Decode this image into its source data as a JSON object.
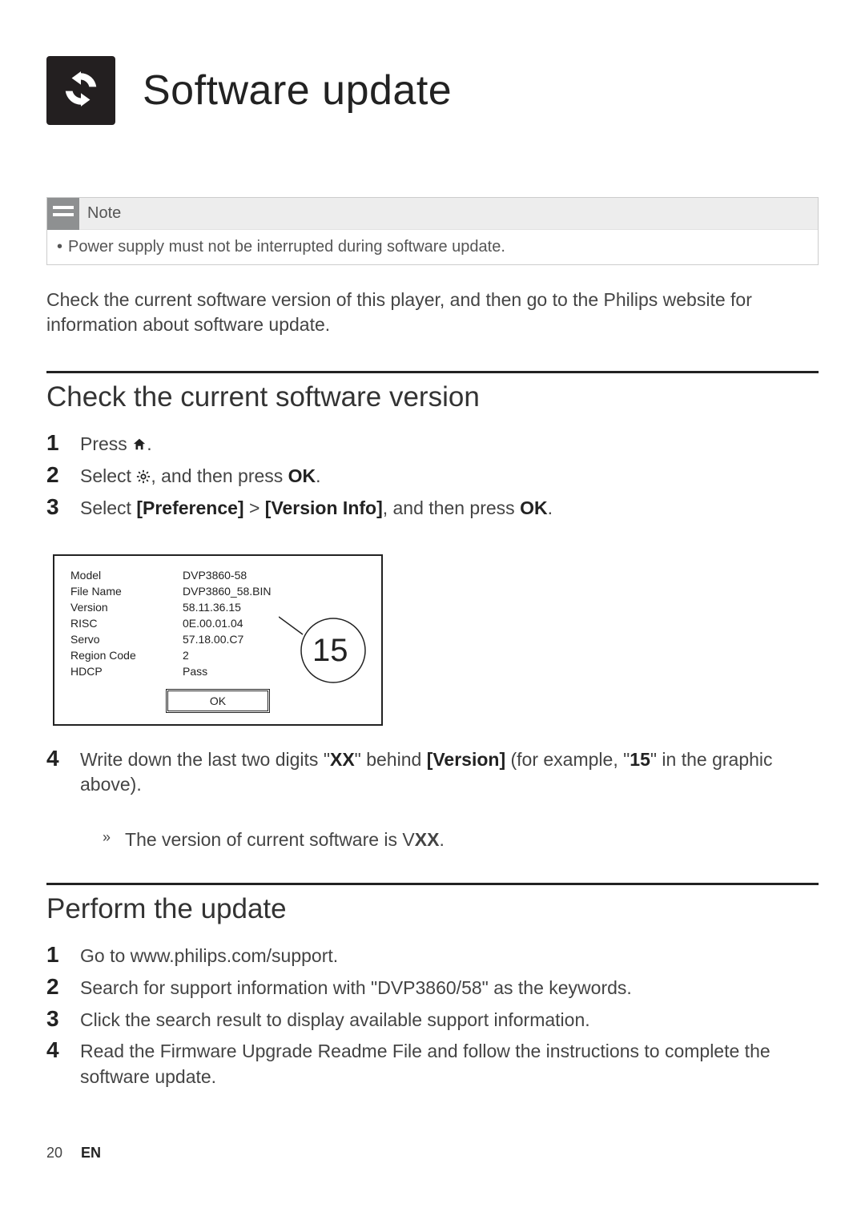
{
  "title": "Software update",
  "note_label": "Note",
  "note_text": "Power supply must not be interrupted during software update.",
  "intro": "Check the current software version of this player, and then go to the Philips website for information about software update.",
  "section1_title": "Check the current software version",
  "steps1": {
    "s1_pre": "Press ",
    "s1_post": ".",
    "s2_pre": "Select ",
    "s2_mid": ", and then press ",
    "s2_ok": "OK",
    "s2_post": ".",
    "s3_pre": "Select ",
    "s3_pref": "[Preference]",
    "s3_gt": " > ",
    "s3_ver": "[Version Info]",
    "s3_mid": ", and then press ",
    "s3_ok": "OK",
    "s3_post": "."
  },
  "version_rows": [
    {
      "label": "Model",
      "value": "DVP3860-58"
    },
    {
      "label": "File Name",
      "value": "DVP3860_58.BIN"
    },
    {
      "label": "Version",
      "value": "58.11.36.15"
    },
    {
      "label": "RISC",
      "value": "0E.00.01.04"
    },
    {
      "label": "Servo",
      "value": "57.18.00.C7"
    },
    {
      "label": "Region Code",
      "value": "2"
    },
    {
      "label": "HDCP",
      "value": "Pass"
    }
  ],
  "callout_num": "15",
  "ok_button": "OK",
  "step4": {
    "pre": "Write down the last two digits \"",
    "xx1": "XX",
    "mid1": "\" behind ",
    "verlbl": "[Version]",
    "mid2": " (for example, \"",
    "ex": "15",
    "mid3": "\" in the graphic above).",
    "sub_pre": "The version of current software is V",
    "sub_xx": "XX",
    "sub_post": "."
  },
  "section2_title": "Perform the update",
  "steps2": [
    "Go to www.philips.com/support.",
    "Search for support information with \"DVP3860/58\" as the keywords.",
    "Click the search result to display available support information.",
    "Read the Firmware Upgrade Readme File and follow the instructions to complete the software update."
  ],
  "footer": {
    "page_num": "20",
    "lang": "EN"
  }
}
